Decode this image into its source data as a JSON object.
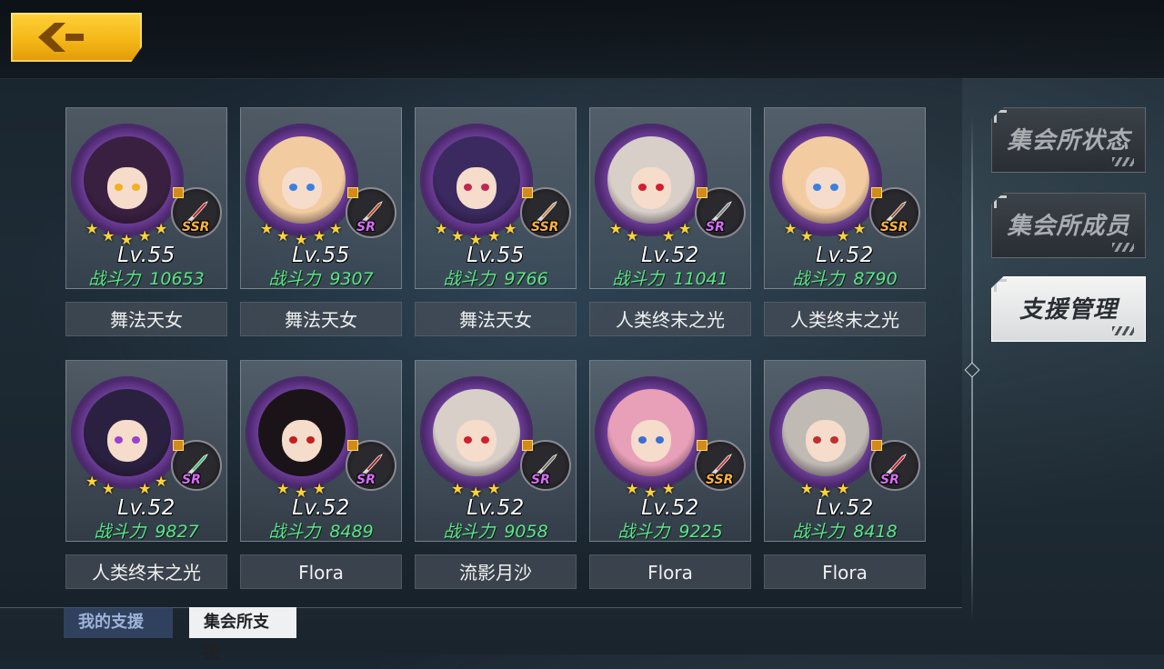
{
  "colors": {
    "accent": "#f3b515",
    "power_green": "#5fe38e",
    "ssr": "#ffb33a",
    "sr": "#d96cff"
  },
  "nav": {
    "back_icon": "chevron-left-icon"
  },
  "side_menu": {
    "items": [
      {
        "label": "集会所状态",
        "active": false
      },
      {
        "label": "集会所成员",
        "active": false
      },
      {
        "label": "支援管理",
        "active": true
      }
    ]
  },
  "cards": [
    {
      "level": "Lv.55",
      "power_label": "战斗力",
      "power": "10653",
      "rarity": "SSR",
      "name": "舞法天女",
      "stars": 5,
      "hair": "#3a2040",
      "eye": "#f0b020",
      "weapon_color": "#c02020"
    },
    {
      "level": "Lv.55",
      "power_label": "战斗力",
      "power": "9307",
      "rarity": "SR",
      "name": "舞法天女",
      "stars": 5,
      "hair": "#f2cba0",
      "eye": "#3a80e0",
      "weapon_color": "#b84a20"
    },
    {
      "level": "Lv.55",
      "power_label": "战斗力",
      "power": "9766",
      "rarity": "SSR",
      "name": "舞法天女",
      "stars": 5,
      "hair": "#3a2a60",
      "eye": "#c02850",
      "weapon_color": "#c89050"
    },
    {
      "level": "Lv.52",
      "power_label": "战斗力",
      "power": "11041",
      "rarity": "SR",
      "name": "人类终末之光",
      "stars": 4,
      "hair": "#d8d0c8",
      "eye": "#d02030",
      "weapon_color": "#888888"
    },
    {
      "level": "Lv.52",
      "power_label": "战斗力",
      "power": "8790",
      "rarity": "SSR",
      "name": "人类终末之光",
      "stars": 4,
      "hair": "#f2cba0",
      "eye": "#3a80e0",
      "weapon_color": "#a06040"
    },
    {
      "level": "Lv.52",
      "power_label": "战斗力",
      "power": "9827",
      "rarity": "SR",
      "name": "人类终末之光",
      "stars": 4,
      "hair": "#2a2040",
      "eye": "#9a40d0",
      "weapon_color": "#40c070"
    },
    {
      "level": "Lv.52",
      "power_label": "战斗力",
      "power": "8489",
      "rarity": "SR",
      "name": "Flora",
      "stars": 3,
      "hair": "#1a1418",
      "eye": "#c02020",
      "weapon_color": "#a02020"
    },
    {
      "level": "Lv.52",
      "power_label": "战斗力",
      "power": "9058",
      "rarity": "SR",
      "name": "流影月沙",
      "stars": 3,
      "hair": "#d8d0c8",
      "eye": "#d02030",
      "weapon_color": "#777766"
    },
    {
      "level": "Lv.52",
      "power_label": "战斗力",
      "power": "9225",
      "rarity": "SSR",
      "name": "Flora",
      "stars": 3,
      "hair": "#e8a0b8",
      "eye": "#3a70d0",
      "weapon_color": "#c04040"
    },
    {
      "level": "Lv.52",
      "power_label": "战斗力",
      "power": "8418",
      "rarity": "SR",
      "name": "Flora",
      "stars": 3,
      "hair": "#c0bab4",
      "eye": "#c03030",
      "weapon_color": "#c02030"
    }
  ],
  "bottom_tabs": [
    {
      "label": "我的支援",
      "active": false
    },
    {
      "label": "集会所支援",
      "active": true
    }
  ]
}
